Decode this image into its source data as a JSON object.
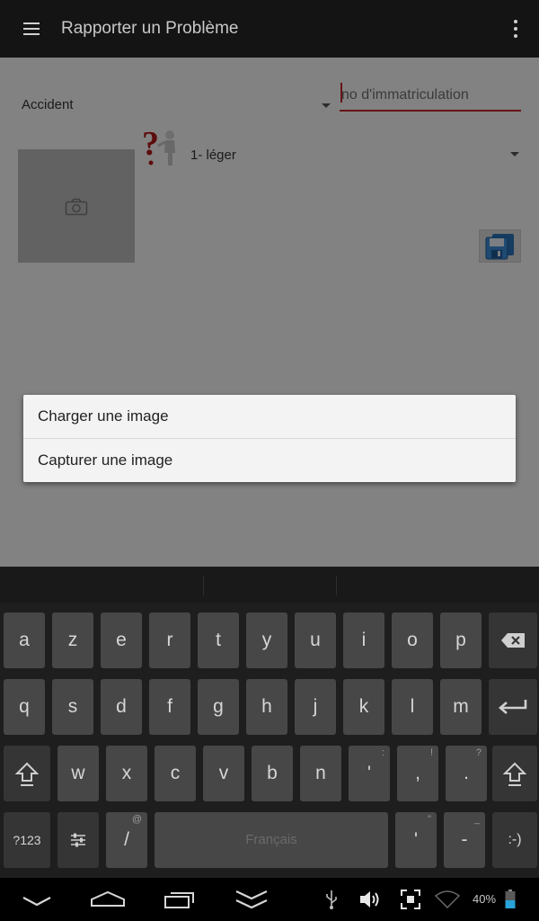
{
  "app_bar": {
    "title": "Rapporter un Problème"
  },
  "form": {
    "type_selected": "Accident",
    "plate_placeholder": "no d'immatriculation",
    "plate_value": "",
    "severity_selected": "1- léger"
  },
  "dialog": {
    "options": [
      "Charger une image",
      "Capturer une image"
    ]
  },
  "keyboard": {
    "rows": [
      [
        "a",
        "z",
        "e",
        "r",
        "t",
        "y",
        "u",
        "i",
        "o",
        "p"
      ],
      [
        "q",
        "s",
        "d",
        "f",
        "g",
        "h",
        "j",
        "k",
        "l",
        "m"
      ],
      [
        "w",
        "x",
        "c",
        "v",
        "b",
        "n"
      ]
    ],
    "punct_row3": [
      ",",
      ".",
      "'"
    ],
    "punct_row3_sub": [
      ":",
      "!",
      "?"
    ],
    "symbols_label": "?123",
    "slash_label": "/",
    "slash_sub": "@",
    "space_label": "Français",
    "apostrophe_label": "'",
    "apostrophe_sub": "\"",
    "dash_label": "-",
    "dash_sub": "_",
    "smiley_label": ":-)"
  },
  "status": {
    "battery": "40%"
  },
  "colors": {
    "accent": "#c0262b",
    "app_bar": "#141414",
    "keyboard": "#1e1e1e"
  }
}
